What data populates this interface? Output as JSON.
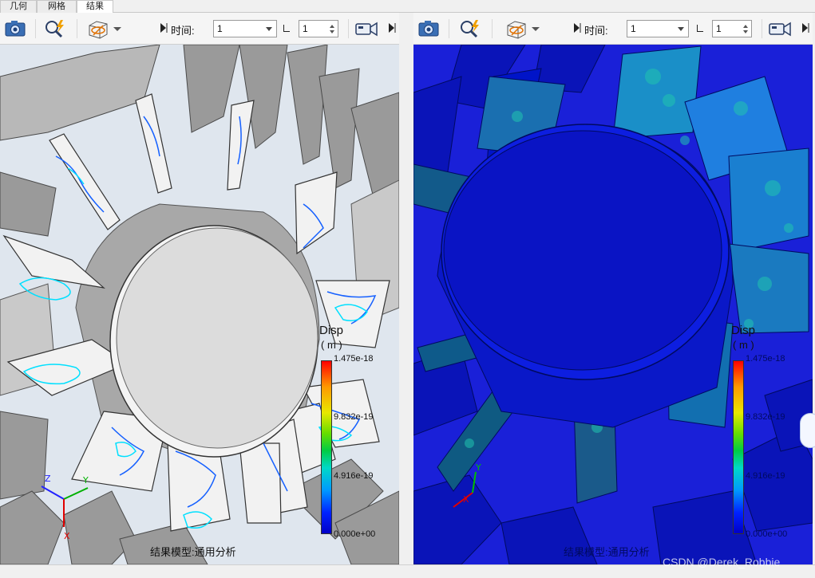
{
  "tabs": [
    {
      "label": "几何"
    },
    {
      "label": "网格"
    },
    {
      "label": "结果"
    }
  ],
  "active_tab": "结果",
  "left_pane": {
    "toolbar": {
      "time_label": "时间:",
      "time_value": "1",
      "step_value": "1",
      "icons": [
        "camera-icon",
        "zoom-lightning-icon",
        "box-view-icon",
        "dropdown-arrow-icon",
        "collapse-icon",
        "video-camera-icon"
      ]
    },
    "legend": {
      "title": "Disp",
      "unit": "( m )",
      "ticks": [
        "1.475e-18",
        "9.832e-19",
        "4.916e-19",
        "0.000e+00"
      ]
    },
    "caption": "结果模型:通用分析",
    "background": "#dfe6ee"
  },
  "right_pane": {
    "toolbar": {
      "time_label": "时间:",
      "time_value": "1",
      "step_value": "1",
      "icons": [
        "camera-icon",
        "zoom-lightning-icon",
        "box-view-icon",
        "dropdown-arrow-icon",
        "collapse-icon",
        "video-camera-icon"
      ]
    },
    "legend": {
      "title": "Disp",
      "unit": "( m )",
      "ticks": [
        "1.475e-18",
        "9.832e-19",
        "4.916e-19",
        "0.000e+00"
      ]
    },
    "caption": "结果模型:通用分析",
    "background": "#1a20d8"
  },
  "watermark": "CSDN @Derek_Robbie",
  "colors": {
    "model_gray": "#d9d9d9",
    "result_blue": "#0a1fd6",
    "contour_cyan": "#00e0ff",
    "contour_blue": "#1560ff"
  }
}
